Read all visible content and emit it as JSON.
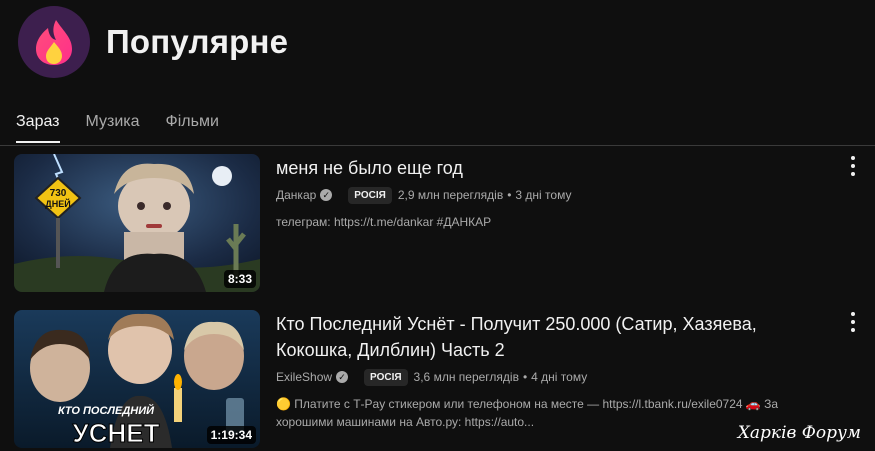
{
  "page": {
    "title": "Популярне"
  },
  "tabs": [
    {
      "label": "Зараз",
      "active": true
    },
    {
      "label": "Музика",
      "active": false
    },
    {
      "label": "Фільми",
      "active": false
    }
  ],
  "videos": [
    {
      "title": "меня не было еще год",
      "channel": "Данкар",
      "badge": "РОСІЯ",
      "views": "2,9 млн переглядів",
      "age": "3 дні тому",
      "description": "телеграм: https://t.me/dankar #ДАНКАР",
      "duration": "8:33",
      "thumb_text": "730\nДНЕЙ"
    },
    {
      "title": "Кто Последний Уснёт - Получит 250.000 (Сатир, Хазяева, Кокошка, Дилблин) Часть 2",
      "channel": "ExileShow",
      "badge": "РОСІЯ",
      "views": "3,6 млн переглядів",
      "age": "4 дні тому",
      "description": "🟡 Платите с Т-Pay стикером или телефоном на месте — https://l.tbank.ru/exile0724 🚗 За хорошими машинами на Авто.ру: https://auto...",
      "duration": "1:19:34",
      "thumb_text_top": "КТО ПОСЛЕДНИЙ",
      "thumb_text_main": "УСНЕТ"
    }
  ],
  "watermark": "Харків Форум"
}
